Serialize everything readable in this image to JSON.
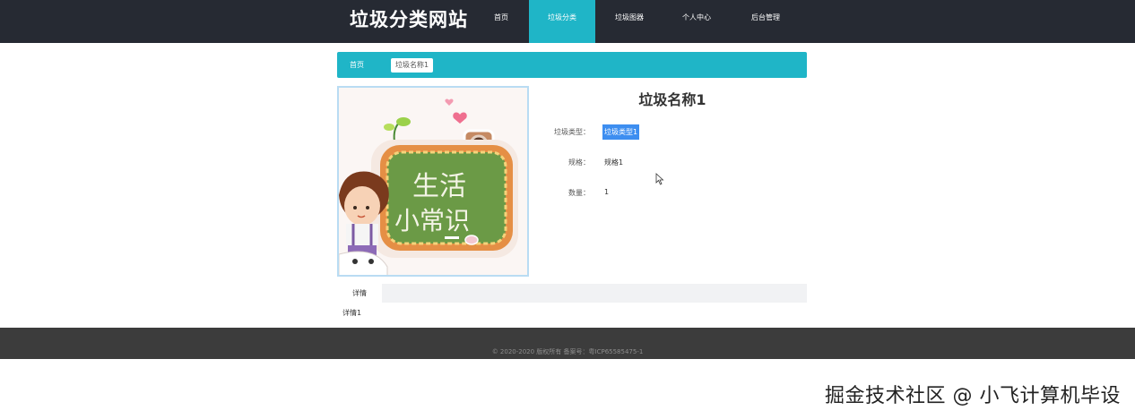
{
  "header": {
    "site_title": "垃圾分类网站",
    "nav": [
      {
        "label": "首页",
        "active": false
      },
      {
        "label": "垃圾分类",
        "active": true
      },
      {
        "label": "垃圾图器",
        "active": false
      },
      {
        "label": "个人中心",
        "active": false
      },
      {
        "label": "后台管理",
        "active": false
      }
    ]
  },
  "breadcrumb": {
    "home": "首页",
    "current": "垃圾名称1"
  },
  "product": {
    "image_text_line1": "生活",
    "image_text_line2": "小常识",
    "title": "垃圾名称1",
    "attributes": [
      {
        "label": "垃圾类型：",
        "value": "垃圾类型1"
      },
      {
        "label": "规格：",
        "value": "规格1"
      },
      {
        "label": "数量：",
        "value": "1"
      }
    ]
  },
  "tabs": {
    "items": [
      "详情"
    ],
    "content": "详情1"
  },
  "footer": {
    "text": "© 2020-2020 版权所有 备案号：粤ICP65585475-1"
  },
  "watermark": "掘金技术社区 @ 小飞计算机毕设",
  "colors": {
    "topbar": "#262a33",
    "accent": "#1fb5c7",
    "footer": "#3c3c3c",
    "selection": "#3d8ef0"
  }
}
